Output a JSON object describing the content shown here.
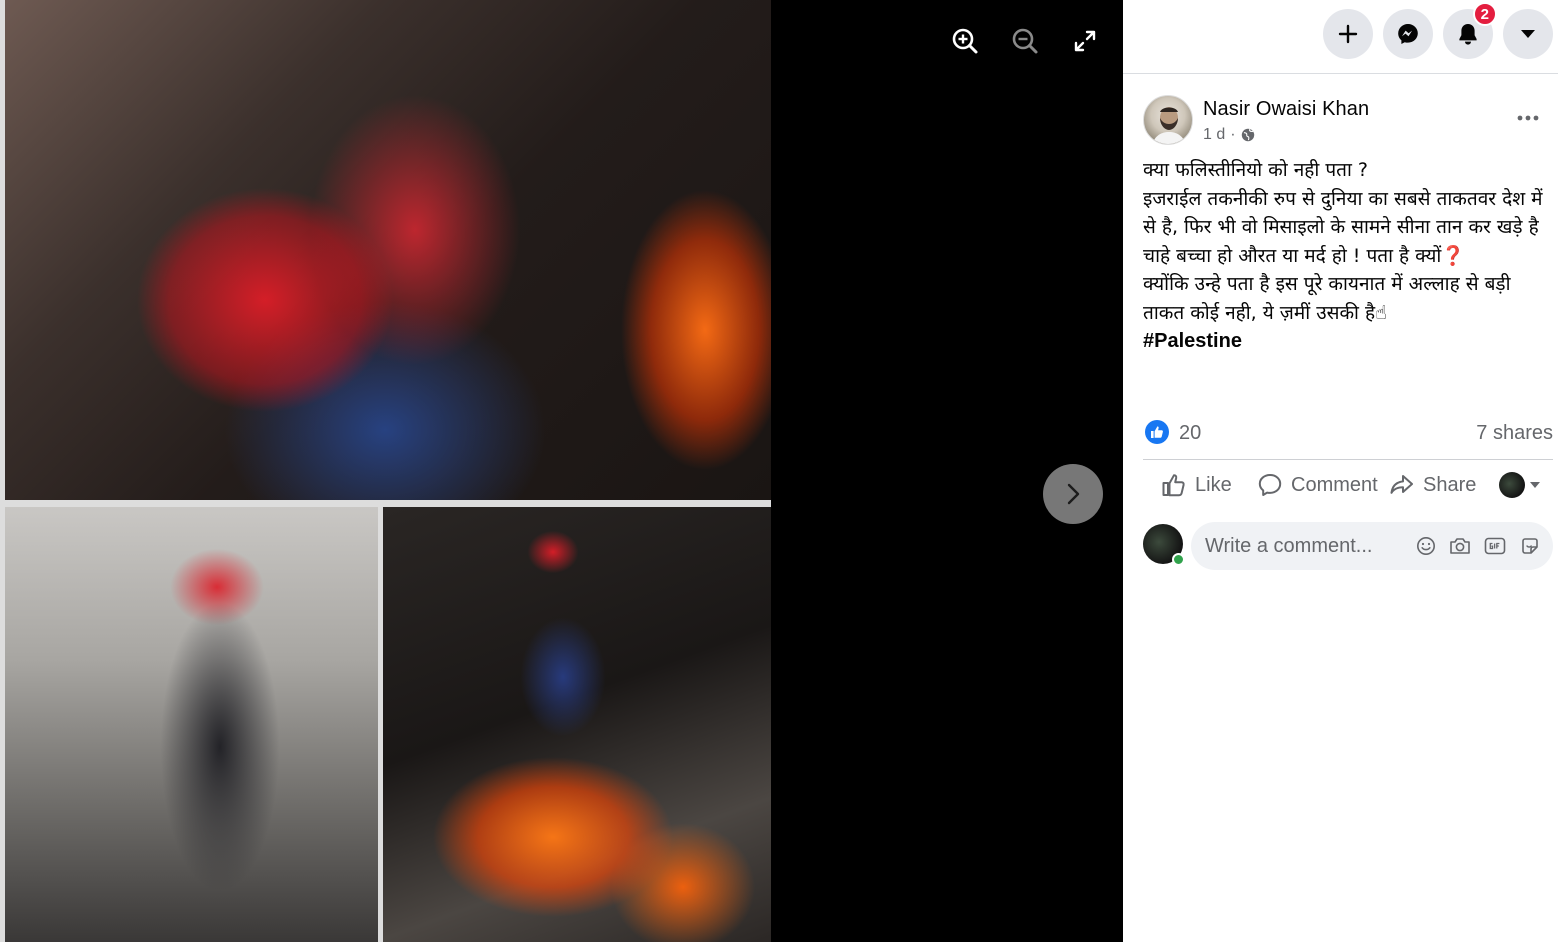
{
  "viewer": {
    "zoom_in_label": "Zoom in",
    "zoom_out_label": "Zoom out",
    "fullscreen_label": "Enter full screen",
    "next_label": "Next photo"
  },
  "topbar": {
    "notifications_count": "2"
  },
  "post": {
    "author": "Nasir Owaisi Khan",
    "time": "1 d",
    "separator": "·",
    "privacy_icon": "globe-icon",
    "lines": [
      "क्या फलिस्तीनियो को नही पता ?",
      "इजराईल तकनीकी रुप से दुनिया का सबसे ताकतवर देश में से है, फिर भी वो मिसाइलो के सामने सीना तान कर खड़े है चाहे बच्चा हो औरत या मर्द हो ! पता है क्यों❓",
      "क्योंकि उन्हे पता है इस पूरे कायनात में अल्लाह से बड़ी ताकत कोई नही, ये ज़मीं उसकी है☝"
    ],
    "hashtag": "#Palestine",
    "reactions_count": "20",
    "shares": "7 shares"
  },
  "actions": {
    "like": "Like",
    "comment": "Comment",
    "share": "Share"
  },
  "comment": {
    "placeholder": "Write a comment..."
  },
  "colors": {
    "accent": "#1877f2",
    "badge": "#e41e3f",
    "online": "#31a24c"
  }
}
